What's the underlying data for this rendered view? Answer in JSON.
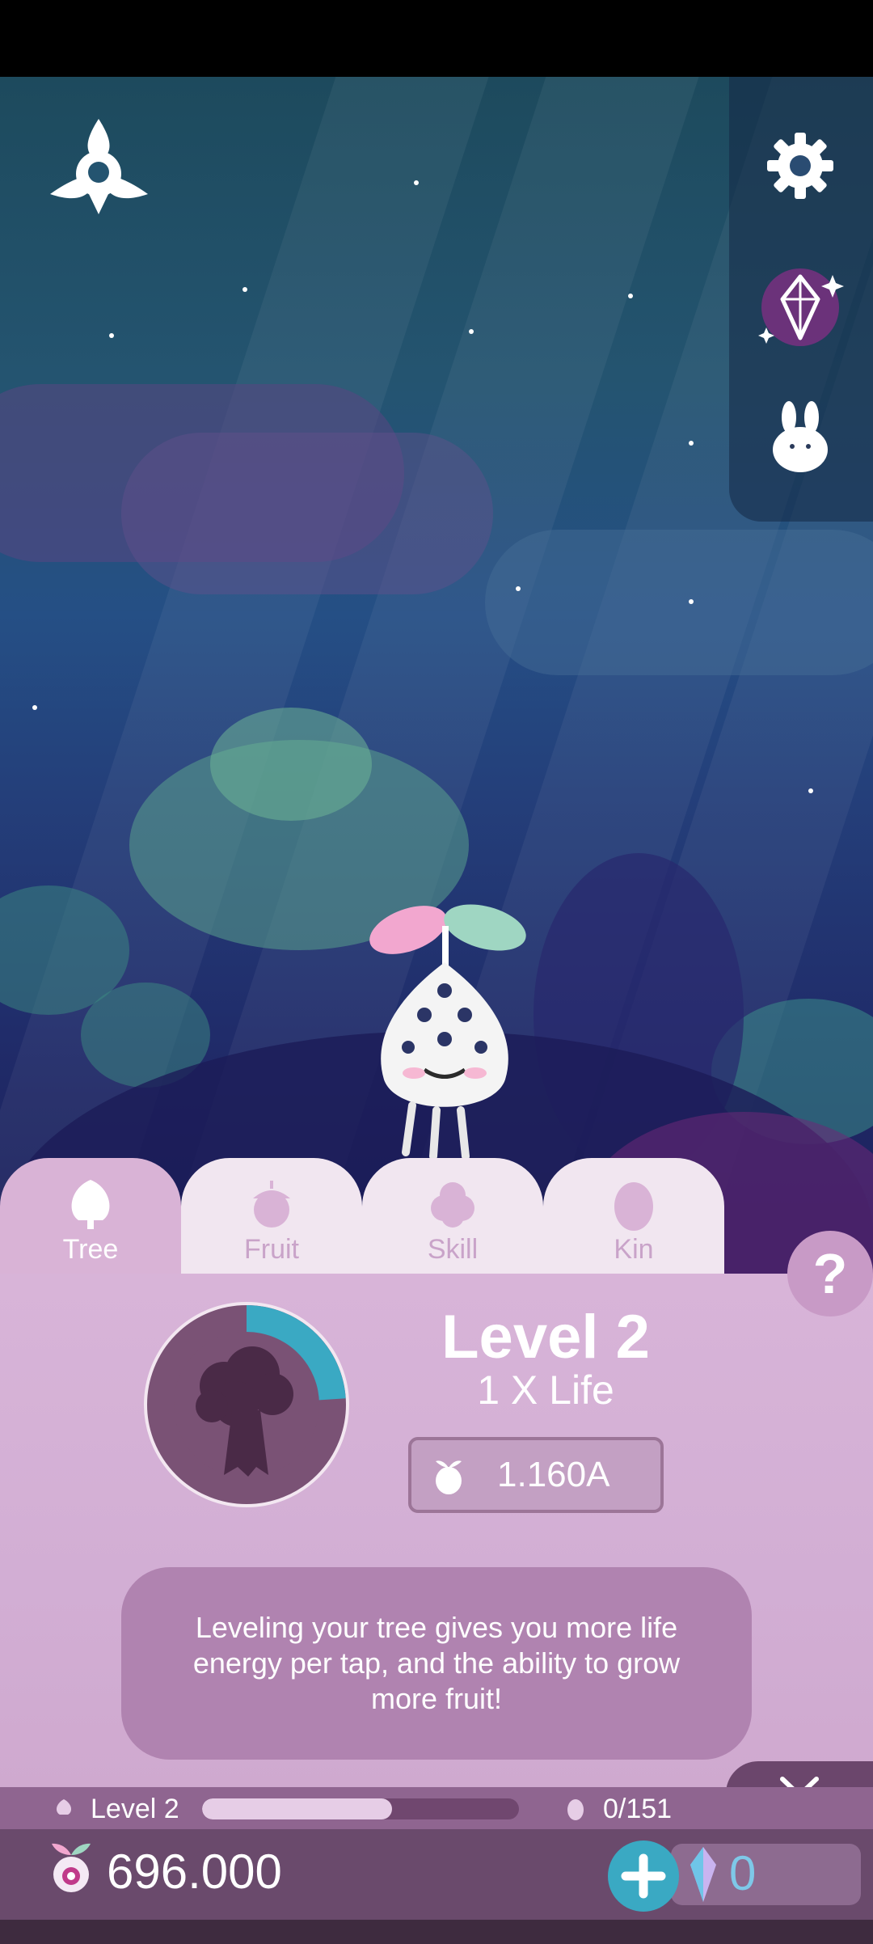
{
  "tabs": [
    {
      "label": "Tree",
      "icon": "tree-icon",
      "active": true
    },
    {
      "label": "Fruit",
      "icon": "acorn-icon",
      "active": false
    },
    {
      "label": "Skill",
      "icon": "cloud-icon",
      "active": false
    },
    {
      "label": "Kin",
      "icon": "egg-icon",
      "active": false
    }
  ],
  "help": {
    "label": "?"
  },
  "level_panel": {
    "title": "Level 2",
    "subtitle": "1 X Life",
    "cost": "1.160A",
    "description": "Leveling your tree gives you more life energy per tap, and the ability to grow more fruit!",
    "portrait_progress": 0.24
  },
  "progress_row": {
    "level_label": "Level 2",
    "progress": 0.6,
    "fruit_count": "0/151"
  },
  "currency": {
    "life_energy": "696.000",
    "crystals": "0"
  },
  "colors": {
    "panel": "#d8b4d8",
    "active_tab": "#d9b3d6",
    "accent_teal": "#3aa9c3",
    "bottom_bar": "#6a4a6c"
  }
}
